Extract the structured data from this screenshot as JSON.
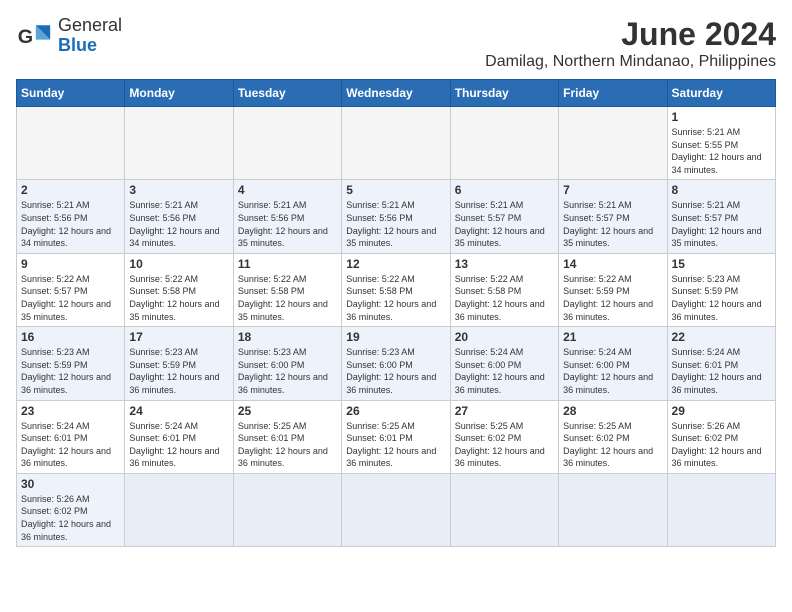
{
  "logo": {
    "text_general": "General",
    "text_blue": "Blue"
  },
  "title": "June 2024",
  "subtitle": "Damilag, Northern Mindanao, Philippines",
  "days_of_week": [
    "Sunday",
    "Monday",
    "Tuesday",
    "Wednesday",
    "Thursday",
    "Friday",
    "Saturday"
  ],
  "weeks": [
    {
      "shade": false,
      "days": [
        {
          "num": "",
          "info": ""
        },
        {
          "num": "",
          "info": ""
        },
        {
          "num": "",
          "info": ""
        },
        {
          "num": "",
          "info": ""
        },
        {
          "num": "",
          "info": ""
        },
        {
          "num": "",
          "info": ""
        },
        {
          "num": "1",
          "info": "Sunrise: 5:21 AM\nSunset: 5:55 PM\nDaylight: 12 hours and 34 minutes."
        }
      ]
    },
    {
      "shade": true,
      "days": [
        {
          "num": "2",
          "info": "Sunrise: 5:21 AM\nSunset: 5:56 PM\nDaylight: 12 hours and 34 minutes."
        },
        {
          "num": "3",
          "info": "Sunrise: 5:21 AM\nSunset: 5:56 PM\nDaylight: 12 hours and 34 minutes."
        },
        {
          "num": "4",
          "info": "Sunrise: 5:21 AM\nSunset: 5:56 PM\nDaylight: 12 hours and 35 minutes."
        },
        {
          "num": "5",
          "info": "Sunrise: 5:21 AM\nSunset: 5:56 PM\nDaylight: 12 hours and 35 minutes."
        },
        {
          "num": "6",
          "info": "Sunrise: 5:21 AM\nSunset: 5:57 PM\nDaylight: 12 hours and 35 minutes."
        },
        {
          "num": "7",
          "info": "Sunrise: 5:21 AM\nSunset: 5:57 PM\nDaylight: 12 hours and 35 minutes."
        },
        {
          "num": "8",
          "info": "Sunrise: 5:21 AM\nSunset: 5:57 PM\nDaylight: 12 hours and 35 minutes."
        }
      ]
    },
    {
      "shade": false,
      "days": [
        {
          "num": "9",
          "info": "Sunrise: 5:22 AM\nSunset: 5:57 PM\nDaylight: 12 hours and 35 minutes."
        },
        {
          "num": "10",
          "info": "Sunrise: 5:22 AM\nSunset: 5:58 PM\nDaylight: 12 hours and 35 minutes."
        },
        {
          "num": "11",
          "info": "Sunrise: 5:22 AM\nSunset: 5:58 PM\nDaylight: 12 hours and 35 minutes."
        },
        {
          "num": "12",
          "info": "Sunrise: 5:22 AM\nSunset: 5:58 PM\nDaylight: 12 hours and 36 minutes."
        },
        {
          "num": "13",
          "info": "Sunrise: 5:22 AM\nSunset: 5:58 PM\nDaylight: 12 hours and 36 minutes."
        },
        {
          "num": "14",
          "info": "Sunrise: 5:22 AM\nSunset: 5:59 PM\nDaylight: 12 hours and 36 minutes."
        },
        {
          "num": "15",
          "info": "Sunrise: 5:23 AM\nSunset: 5:59 PM\nDaylight: 12 hours and 36 minutes."
        }
      ]
    },
    {
      "shade": true,
      "days": [
        {
          "num": "16",
          "info": "Sunrise: 5:23 AM\nSunset: 5:59 PM\nDaylight: 12 hours and 36 minutes."
        },
        {
          "num": "17",
          "info": "Sunrise: 5:23 AM\nSunset: 5:59 PM\nDaylight: 12 hours and 36 minutes."
        },
        {
          "num": "18",
          "info": "Sunrise: 5:23 AM\nSunset: 6:00 PM\nDaylight: 12 hours and 36 minutes."
        },
        {
          "num": "19",
          "info": "Sunrise: 5:23 AM\nSunset: 6:00 PM\nDaylight: 12 hours and 36 minutes."
        },
        {
          "num": "20",
          "info": "Sunrise: 5:24 AM\nSunset: 6:00 PM\nDaylight: 12 hours and 36 minutes."
        },
        {
          "num": "21",
          "info": "Sunrise: 5:24 AM\nSunset: 6:00 PM\nDaylight: 12 hours and 36 minutes."
        },
        {
          "num": "22",
          "info": "Sunrise: 5:24 AM\nSunset: 6:01 PM\nDaylight: 12 hours and 36 minutes."
        }
      ]
    },
    {
      "shade": false,
      "days": [
        {
          "num": "23",
          "info": "Sunrise: 5:24 AM\nSunset: 6:01 PM\nDaylight: 12 hours and 36 minutes."
        },
        {
          "num": "24",
          "info": "Sunrise: 5:24 AM\nSunset: 6:01 PM\nDaylight: 12 hours and 36 minutes."
        },
        {
          "num": "25",
          "info": "Sunrise: 5:25 AM\nSunset: 6:01 PM\nDaylight: 12 hours and 36 minutes."
        },
        {
          "num": "26",
          "info": "Sunrise: 5:25 AM\nSunset: 6:01 PM\nDaylight: 12 hours and 36 minutes."
        },
        {
          "num": "27",
          "info": "Sunrise: 5:25 AM\nSunset: 6:02 PM\nDaylight: 12 hours and 36 minutes."
        },
        {
          "num": "28",
          "info": "Sunrise: 5:25 AM\nSunset: 6:02 PM\nDaylight: 12 hours and 36 minutes."
        },
        {
          "num": "29",
          "info": "Sunrise: 5:26 AM\nSunset: 6:02 PM\nDaylight: 12 hours and 36 minutes."
        }
      ]
    },
    {
      "shade": true,
      "days": [
        {
          "num": "30",
          "info": "Sunrise: 5:26 AM\nSunset: 6:02 PM\nDaylight: 12 hours and 36 minutes."
        },
        {
          "num": "",
          "info": ""
        },
        {
          "num": "",
          "info": ""
        },
        {
          "num": "",
          "info": ""
        },
        {
          "num": "",
          "info": ""
        },
        {
          "num": "",
          "info": ""
        },
        {
          "num": "",
          "info": ""
        }
      ]
    }
  ]
}
